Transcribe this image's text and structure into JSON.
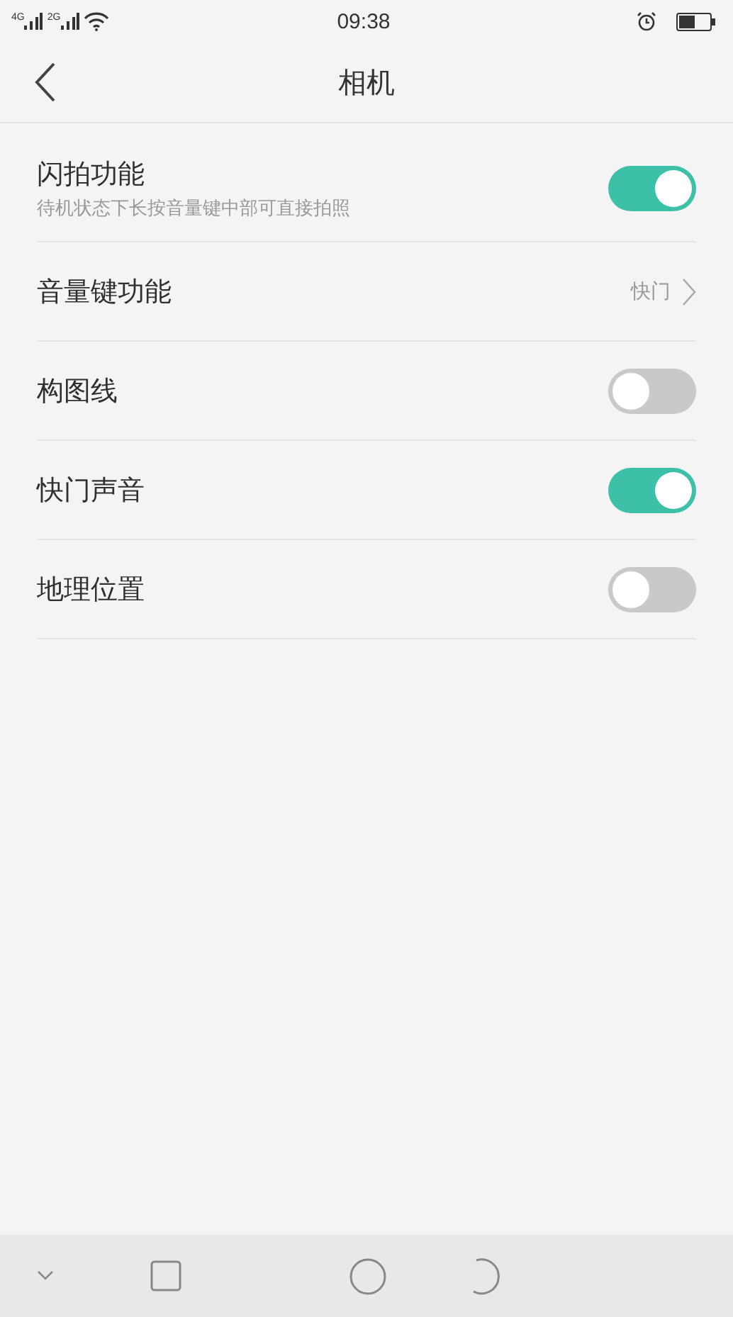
{
  "status_bar": {
    "networks": [
      "4G",
      "2G"
    ],
    "time": "09:38"
  },
  "header": {
    "title": "相机"
  },
  "settings": [
    {
      "kind": "toggle",
      "title": "闪拍功能",
      "subtitle": "待机状态下长按音量键中部可直接拍照",
      "on": true
    },
    {
      "kind": "link",
      "title": "音量键功能",
      "value": "快门"
    },
    {
      "kind": "toggle",
      "title": "构图线",
      "on": false
    },
    {
      "kind": "toggle",
      "title": "快门声音",
      "on": true
    },
    {
      "kind": "toggle",
      "title": "地理位置",
      "on": false
    }
  ]
}
